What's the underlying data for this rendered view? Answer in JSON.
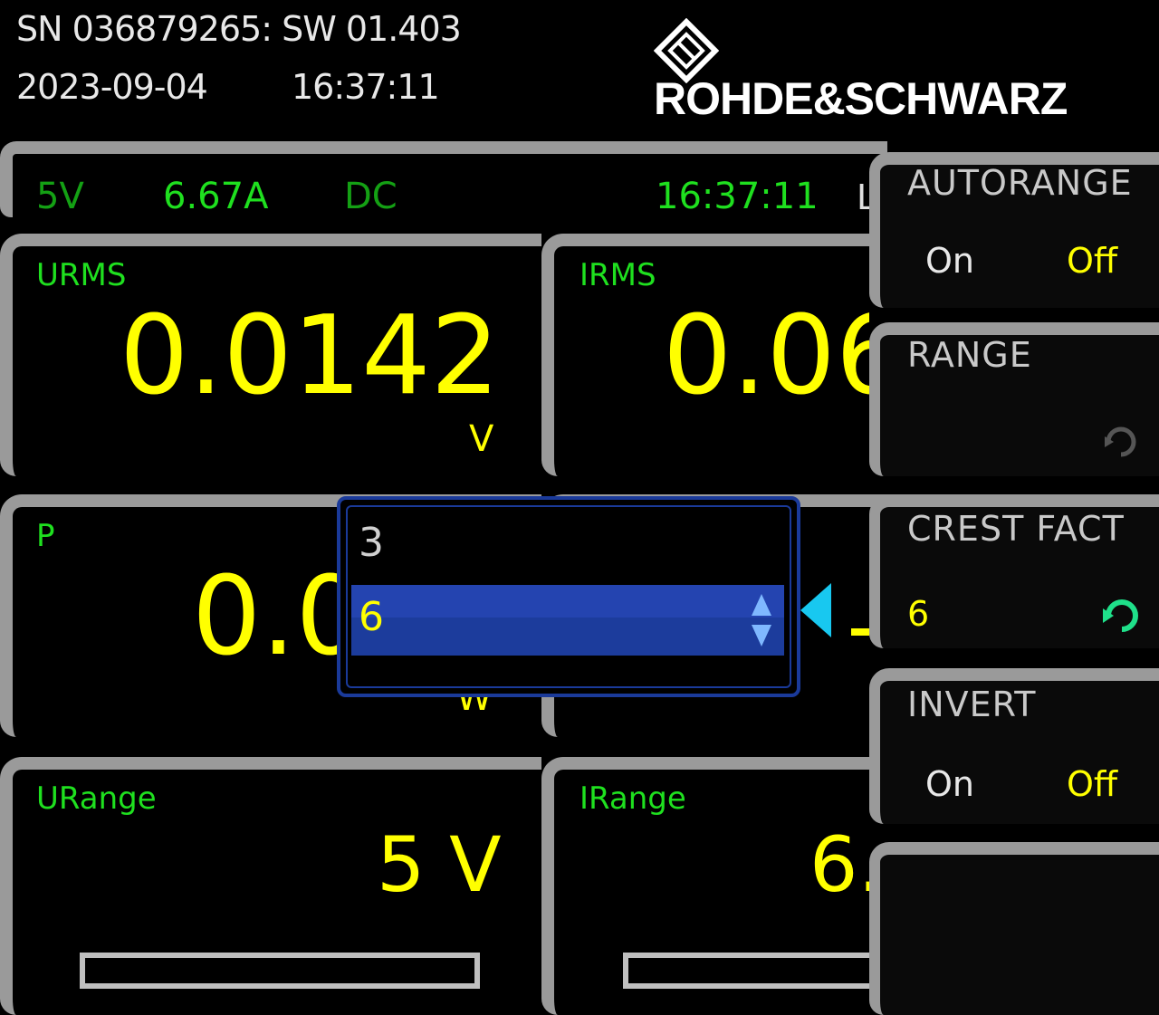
{
  "header": {
    "serial_line": "SN 036879265: SW 01.403",
    "date": "2023-09-04",
    "time": "16:37:11",
    "brand": "ROHDE&SCHWARZ"
  },
  "status": {
    "voltage_range": "5V",
    "current_range": "6.67A",
    "coupling": "DC",
    "clock": "16:37:11",
    "clipped_char": "L"
  },
  "tiles": [
    {
      "label": "URMS",
      "value": "0.0142",
      "unit": "V"
    },
    {
      "label": "IRMS",
      "value": "0.06"
    },
    {
      "label": "P",
      "value": "0.0",
      "unit": "W"
    },
    {
      "label": "URange",
      "value": "5 V"
    },
    {
      "label": "IRange",
      "value": "6."
    }
  ],
  "popup": {
    "options": [
      "3",
      "6"
    ],
    "selected": "6",
    "selected_index": 1
  },
  "softkeys": [
    {
      "title": "AUTORANGE",
      "on": "On",
      "off": "Off",
      "active": "Off"
    },
    {
      "title": "RANGE"
    },
    {
      "title": "CREST FACT",
      "value": "6"
    },
    {
      "title": "INVERT",
      "on": "On",
      "off": "Off",
      "active": "Off"
    },
    {
      "title": ""
    }
  ],
  "colors": {
    "label_green": "#1fe01f",
    "value_yellow": "#ffff00",
    "selection_blue": "#1a3a9a",
    "pointer_cyan": "#18c8f0"
  }
}
